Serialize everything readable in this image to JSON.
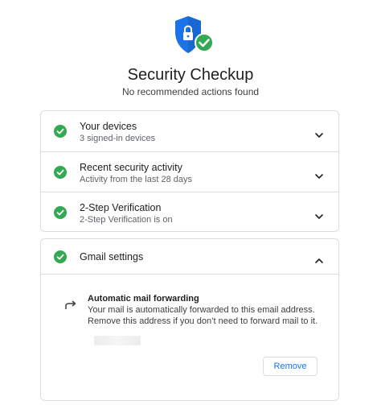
{
  "header": {
    "title": "Security Checkup",
    "subtitle": "No recommended actions found"
  },
  "colors": {
    "shield_blue": "#1a73e8",
    "check_green": "#34a853",
    "link_blue": "#1a73e8",
    "border": "#dadce0"
  },
  "icons": {
    "shield": "shield-lock-icon",
    "check": "check-circle-icon",
    "chevron_down": "chevron-down-icon",
    "chevron_up": "chevron-up-icon",
    "forward": "forward-arrow-icon"
  },
  "items": [
    {
      "title": "Your devices",
      "subtitle": "3 signed-in devices"
    },
    {
      "title": "Recent security activity",
      "subtitle": "Activity from the last 28 days"
    },
    {
      "title": "2-Step Verification",
      "subtitle": "2-Step Verification is on"
    }
  ],
  "gmail": {
    "title": "Gmail settings",
    "forwarding_title": "Automatic mail forwarding",
    "forwarding_line1": "Your mail is automatically forwarded to this email address.",
    "forwarding_line2": "Remove this address if you don’t need to forward mail to it.",
    "remove_label": "Remove"
  }
}
